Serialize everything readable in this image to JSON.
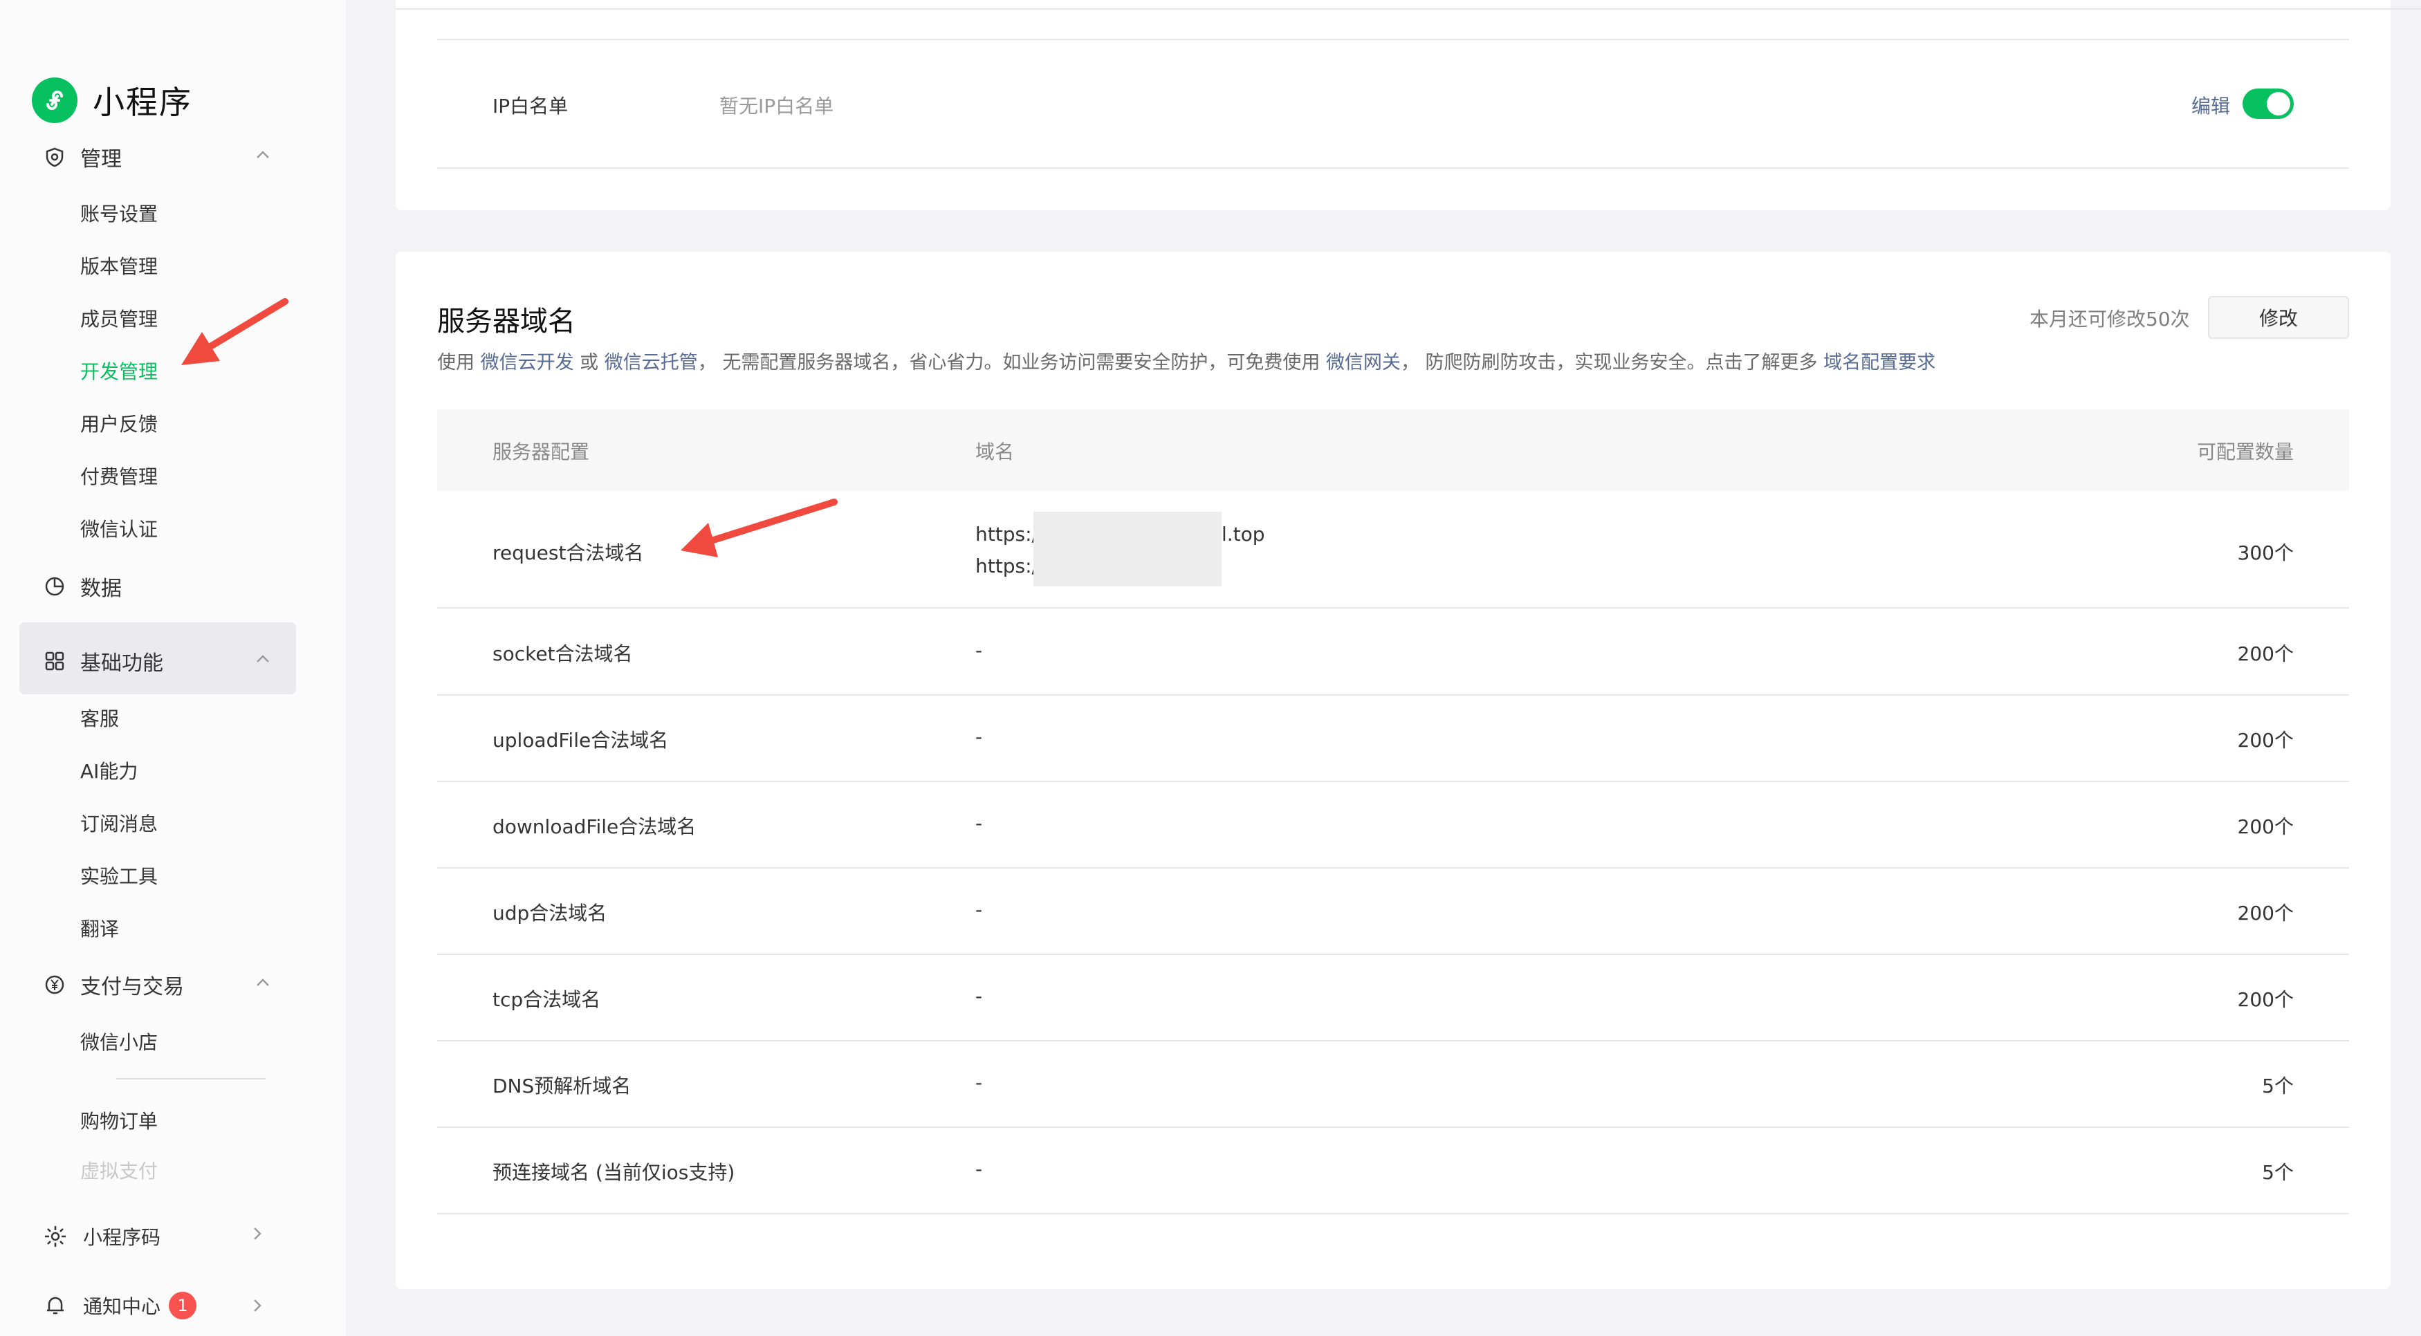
{
  "brand": {
    "name": "小程序"
  },
  "sidebar": {
    "manage": {
      "label": "管理",
      "items": [
        "账号设置",
        "版本管理",
        "成员管理",
        "开发管理",
        "用户反馈",
        "付费管理",
        "微信认证"
      ],
      "active": "开发管理"
    },
    "data": {
      "label": "数据"
    },
    "basic": {
      "label": "基础功能",
      "items": [
        "客服",
        "AI能力",
        "订阅消息",
        "实验工具",
        "翻译"
      ]
    },
    "pay": {
      "label": "支付与交易",
      "items": [
        "微信小店",
        "购物订单"
      ],
      "faded": "虚拟支付"
    },
    "bottom": {
      "qrcode": "小程序码",
      "notice": "通知中心",
      "notice_badge": "1"
    }
  },
  "ip_whitelist": {
    "label": "IP白名单",
    "value": "暂无IP白名单",
    "edit": "编辑",
    "enabled": true
  },
  "server_domain": {
    "title": "服务器域名",
    "remaining": "本月还可修改50次",
    "modify_button": "修改",
    "desc": {
      "p1": "使用 ",
      "l1": "微信云开发",
      "p2": " 或 ",
      "l2": "微信云托管",
      "p3": "， 无需配置服务器域名，省心省力。如业务访问需要安全防护，可免费使用 ",
      "l3": "微信网关",
      "p4": "， 防爬防刷防攻击，实现业务安全。点击了解更多 ",
      "l4": "域名配置要求"
    },
    "columns": [
      "服务器配置",
      "域名",
      "可配置数量"
    ],
    "rows": [
      {
        "config": "request合法域名",
        "domain1": "https://",
        "domain1_suffix": "l.top",
        "domain2": "https://",
        "count": "300个"
      },
      {
        "config": "socket合法域名",
        "domain": "-",
        "count": "200个"
      },
      {
        "config": "uploadFile合法域名",
        "domain": "-",
        "count": "200个"
      },
      {
        "config": "downloadFile合法域名",
        "domain": "-",
        "count": "200个"
      },
      {
        "config": "udp合法域名",
        "domain": "-",
        "count": "200个"
      },
      {
        "config": "tcp合法域名",
        "domain": "-",
        "count": "200个"
      },
      {
        "config": "DNS预解析域名",
        "domain": "-",
        "count": "5个"
      },
      {
        "config": "预连接域名 (当前仅ios支持)",
        "domain": "-",
        "count": "5个"
      }
    ]
  },
  "colors": {
    "accent": "#07c160",
    "link": "#576b95",
    "arrow": "#f04a3e",
    "badge": "#fa5151"
  }
}
